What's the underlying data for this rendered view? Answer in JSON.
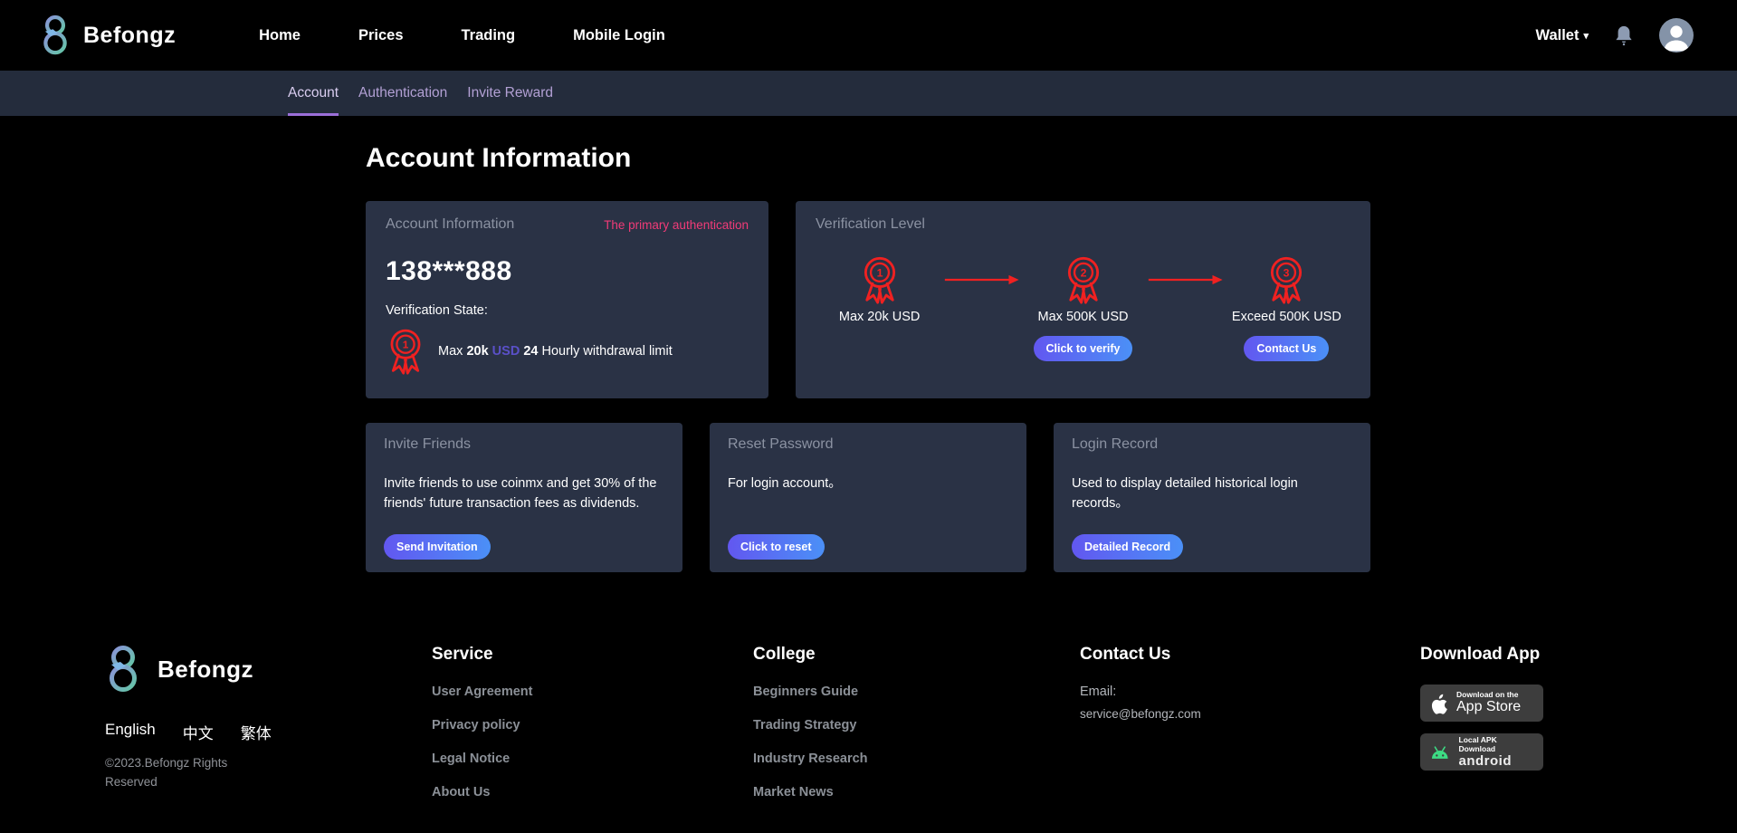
{
  "header": {
    "brand": "Befongz",
    "nav": [
      "Home",
      "Prices",
      "Trading",
      "Mobile Login"
    ],
    "wallet_label": "Wallet",
    "wallet_caret": "▾"
  },
  "subnav": {
    "tabs": [
      "Account",
      "Authentication",
      "Invite Reward"
    ],
    "active": "Account"
  },
  "page": {
    "title": "Account Information"
  },
  "account_card": {
    "title": "Account Information",
    "badge_note": "The primary authentication",
    "phone": "138***888",
    "verification_state_label": "Verification State:",
    "level_number": "1",
    "limit": {
      "prefix": "Max",
      "amount": "20k",
      "currency": "USD",
      "hours": "24",
      "suffix": "Hourly withdrawal limit"
    }
  },
  "verification_card": {
    "title": "Verification Level",
    "levels": [
      {
        "number": "1",
        "label": "Max 20k USD"
      },
      {
        "number": "2",
        "label": "Max 500K USD",
        "button": "Click to verify"
      },
      {
        "number": "3",
        "label": "Exceed 500K USD",
        "button": "Contact Us"
      }
    ]
  },
  "action_cards": [
    {
      "title": "Invite Friends",
      "body": "Invite friends to use coinmx and get 30% of the friends' future transaction fees as dividends.",
      "button": "Send Invitation"
    },
    {
      "title": "Reset Password",
      "body": "For login account。",
      "button": "Click to reset"
    },
    {
      "title": "Login Record",
      "body": "Used to display detailed historical login records。",
      "button": "Detailed Record"
    }
  ],
  "footer": {
    "brand": "Befongz",
    "languages": [
      "English",
      "中文",
      "繁体"
    ],
    "copyright": "©2023.Befongz Rights Reserved",
    "service": {
      "title": "Service",
      "links": [
        "User Agreement",
        "Privacy policy",
        "Legal Notice",
        "About Us"
      ]
    },
    "college": {
      "title": "College",
      "links": [
        "Beginners Guide",
        "Trading Strategy",
        "Industry Research",
        "Market News"
      ]
    },
    "contact": {
      "title": "Contact Us",
      "email_label": "Email:",
      "email": "service@befongz.com"
    },
    "download": {
      "title": "Download App",
      "appstore_small": "Download on the",
      "appstore_big": "App Store",
      "android_small": "Local APK Download",
      "android_big": "android"
    }
  },
  "colors": {
    "accent_red": "#f02121",
    "accent_pink": "#f13b78",
    "accent_purple": "#5a50c8",
    "tab_underline": "#9b6fd8",
    "button_gradient_start": "#6257f0",
    "button_gradient_end": "#4b90f7",
    "card_bg": "#2a3245",
    "subnav_bg": "#242c3c",
    "android_green": "#3ddc84"
  }
}
